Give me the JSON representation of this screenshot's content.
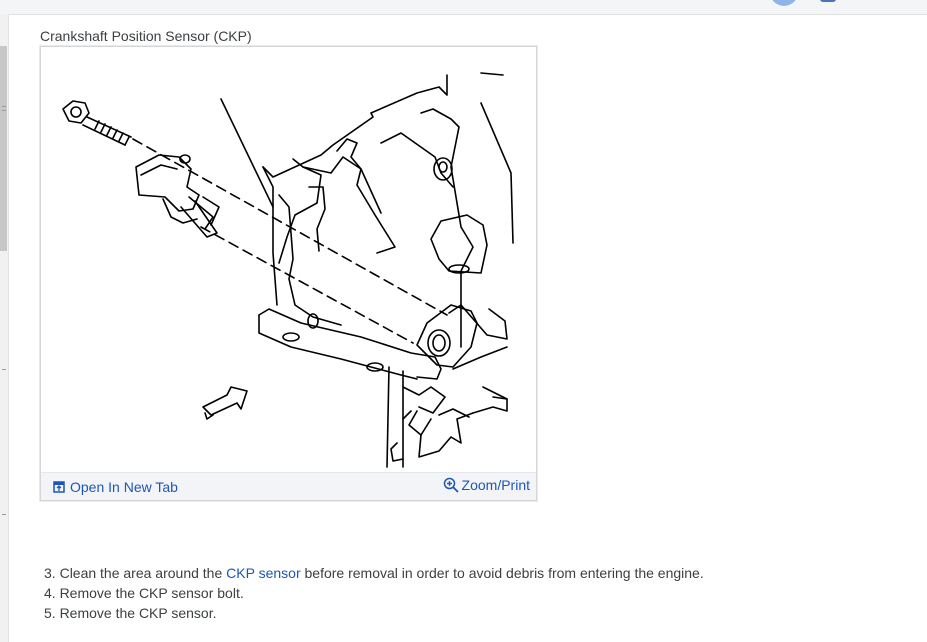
{
  "figure": {
    "title": "Crankshaft Position Sensor (CKP)",
    "open_label": "Open In New Tab",
    "zoom_label": "Zoom/Print"
  },
  "steps": {
    "s3": {
      "num": "3.",
      "before": "Clean the area around the",
      "link": "CKP sensor",
      "after": "before removal in order to avoid debris from entering the engine."
    },
    "s4": "4. Remove the CKP sensor bolt.",
    "s5": "5. Remove the CKP sensor."
  },
  "colors": {
    "link": "#1f56b3",
    "text": "#3c4043"
  },
  "icons": [
    "open-tab-icon",
    "zoom-in-icon"
  ]
}
